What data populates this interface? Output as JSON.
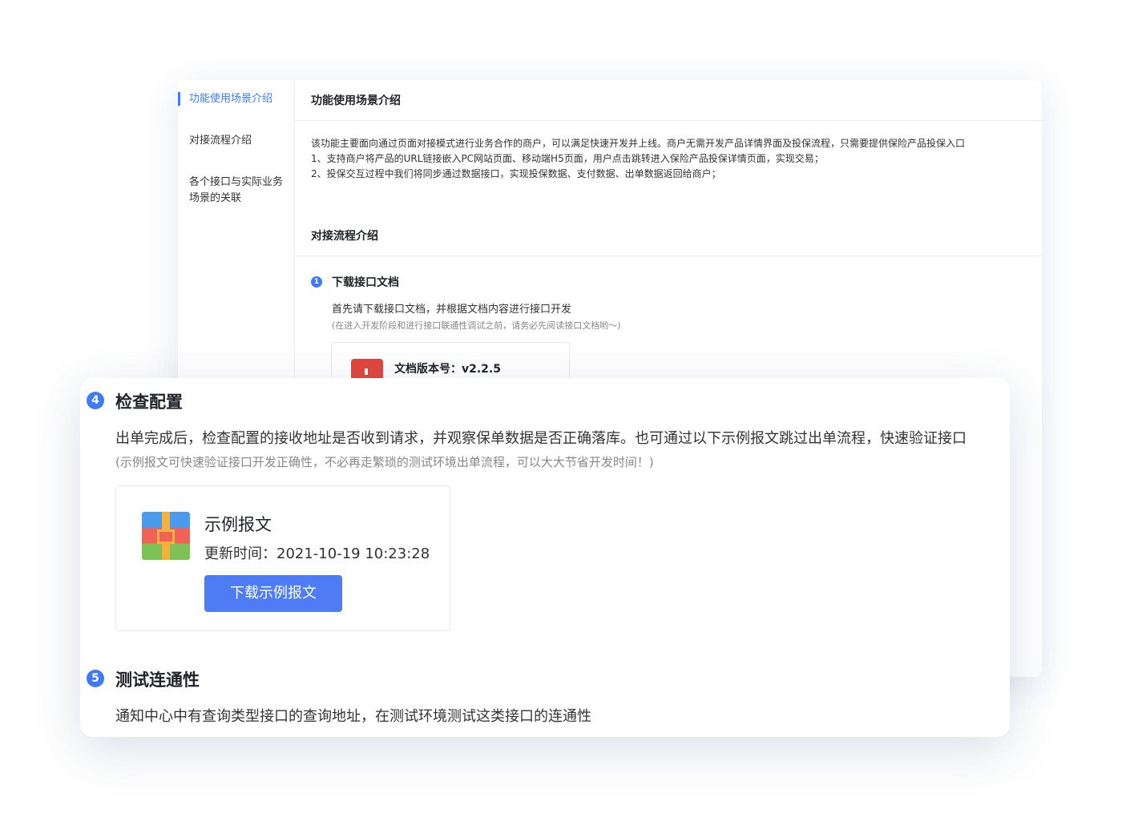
{
  "sidebar": {
    "items": [
      {
        "label": "功能使用场景介绍"
      },
      {
        "label": "对接流程介绍"
      },
      {
        "label": "各个接口与实际业务场景的关联"
      }
    ]
  },
  "doc": {
    "section1_title": "功能使用场景介绍",
    "intro_lines": [
      "该功能主要面向通过页面对接模式进行业务合作的商户，可以满足快速开发并上线。商户无需开发产品详情界面及投保流程，只需要提供保险产品投保入口",
      "1、支持商户将产品的URL链接嵌入PC网站页面、移动端H5页面，用户点击跳转进入保险产品投保详情页面，实现交易；",
      "2、投保交互过程中我们将同步通过数据接口，实现投保数据、支付数据、出单数据返回给商户；"
    ],
    "section2_title": "对接流程介绍",
    "step1": {
      "number": "1",
      "title": "下载接口文档",
      "desc": "首先请下载接口文档，并根据文档内容进行接口开发",
      "note": "(在进入开发阶段和进行接口联通性调试之前，请务必先阅读接口文档哟～)"
    },
    "doc_card": {
      "version_label": "文档版本号：v2.2.5"
    }
  },
  "front": {
    "step4": {
      "number": "4",
      "title": "检查配置",
      "desc": "出单完成后，检查配置的接收地址是否收到请求，并观察保单数据是否正确落库。也可通过以下示例报文跳过出单流程，快速验证接口",
      "note": "(示例报文可快速验证接口开发正确性，不必再走繁琐的测试环境出单流程，可以大大节省开发时间！)"
    },
    "sample_card": {
      "title": "示例报文",
      "time": "更新时间：2021-10-19 10:23:28",
      "button": "下载示例报文"
    },
    "step5": {
      "number": "5",
      "title": "测试连通性",
      "desc": "通知中心中有查询类型接口的查询地址，在测试环境测试这类接口的连通性"
    }
  },
  "colors": {
    "accent": "#3e7bfa",
    "button": "#4d7cf5",
    "pdf": "#e0473d"
  }
}
